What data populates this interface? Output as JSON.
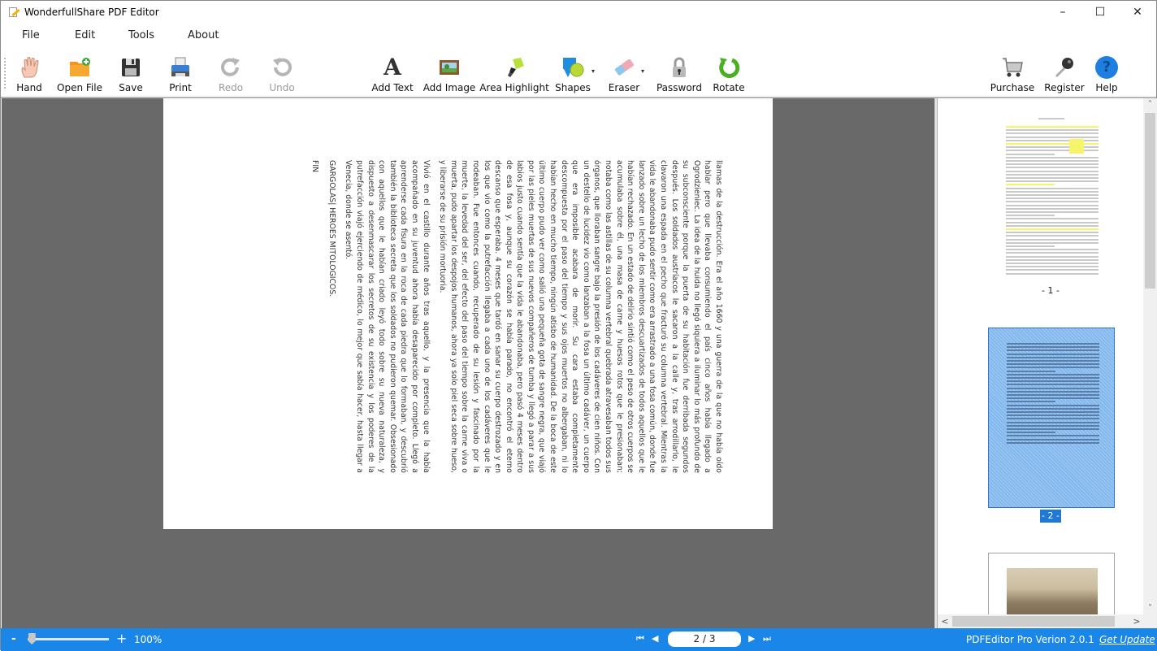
{
  "window": {
    "title": "WonderfullShare PDF Editor",
    "controls": {
      "minimize": "–",
      "maximize": "☐",
      "close": "✕"
    }
  },
  "menu": [
    "File",
    "Edit",
    "Tools",
    "About"
  ],
  "toolbar": {
    "hand": "Hand",
    "open_file": "Open File",
    "save": "Save",
    "print": "Print",
    "redo": "Redo",
    "undo": "Undo",
    "add_text": "Add Text",
    "add_image": "Add Image",
    "area_highlight": "Area Highlight",
    "shapes": "Shapes",
    "eraser": "Eraser",
    "password": "Password",
    "rotate": "Rotate",
    "purchase": "Purchase",
    "register": "Register",
    "help": "Help",
    "dropdown_glyph": "▾",
    "add_text_glyph": "A",
    "help_glyph": "?"
  },
  "document": {
    "paragraphs": [
      "llamas de la destrucción. Era el año 1660 y una guerra de la que no había oído hablar pero que llevaba consumiendo el país cinco años había llegado a Ogrodzieniec. La idea de la huida no llegó siquiera a iluminar lo más profundo de su subconsciente porque la puerta de su habitación fue derribada segundos después. Los soldados austríacos le sacaron a la calle y, tras arrodillarlo, le clavaron una espada en el pecho que fracturó su columna vertebral. Mientras la vida le abandonaba pudo sentir como era arrastrado a una fosa común, donde fue lanzado sobre un lecho de los miembros descuartizados de todos aquellos que le habían rechazado. En un estado de delirio sintió como el peso de otros cuerpos se acumulaba sobre él, una masa de carne y huesos rotos que le presionaban; notaba como las astillas de su columna vertebral quebrada atravesaban todos sus órganos, que lloraban sangre bajo la presión de los cadáveres de cien niños. Con un destello de lucidez vio como lanzaban a la fosa un último cadáver, un cuerpo que era imposible acabara de morir. Su cara estaba completamente descompuesta por el paso del tiempo y sus ojos muertos no albergaban, ni lo habían hecho en mucho tiempo, ningún atisbo de humanidad. De la boca de este último cuerpo pudo ver como salió una pequeña gota de sangre negra, que viajó por las pieles muertas de sus nuevos compañeros de tumba y llegó a parar a sus labios justo cuando sentía que la vida le abandonaba, pero pasó 4 meses dentro de esa fosa y, aunque su corazón se había parado, no encontró el eterno descanso que esperaba. 4 meses que tardó en sanar su cuerpo destrozado y en los que vio como la putrefacción llegaba a cada uno de los cadáveres que le rodeaban. Fue entonces cuando, recuperado de su lesión y fascinado por la muerte, la levedad del ser, del efecto del paso del tiempo sobre la carne viva o muerta, pudo apartar los despojos humanos, ahora ya solo piel seca sobre hueso, y liberarse de su prisión mortuoria.",
      "Vivió en el castillo durante años tras aquello, y la presencia que la había acompañado en su juventud ahora había desaparecido por completo. Llegó a aprenderse cada fisura en la roca de cada piedra que lo formaban, y descubrió también la biblioteca secreta que los soldados no pudieron quemar. Obsesionado con aquellos que le habían criado leyó todo sobre su nueva naturaleza, y dispuesto a desenmascarar los secretos de su existencia y los poderes de la putrefacción viajó ejerciendo de médico, lo mejor que sabía hacer, hasta llegar a Venecia, donde se asentó.",
      "GARGOLAS| HEROES MITOLOGICOS.",
      "FIN"
    ]
  },
  "thumbnails": [
    {
      "label": "- 1 -",
      "selected": false
    },
    {
      "label": "- 2 -",
      "selected": true
    },
    {
      "label": "",
      "selected": false
    }
  ],
  "scroll": {
    "up": "˄",
    "down": "˅",
    "left": "<",
    "right": ">"
  },
  "statusbar": {
    "zoom_minus": "-",
    "zoom_plus": "+",
    "zoom_level": "100%",
    "zoom_fraction": 0.05,
    "first_page": "⏮",
    "prev_page": "◀",
    "next_page": "▶",
    "last_page": "⏭",
    "page_indicator": "2  / 3",
    "version": "PDFEditor Pro Verion 2.0.1",
    "update_link": "Get Update"
  }
}
